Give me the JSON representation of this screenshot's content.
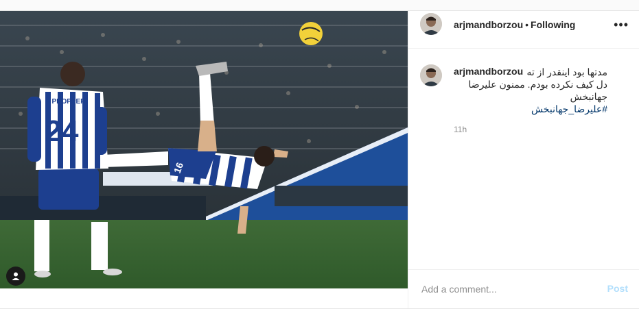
{
  "header": {
    "username": "arjmandborzou",
    "separator": "•",
    "follow_status": "Following",
    "more_icon": "more-horizontal-icon"
  },
  "caption": {
    "username": "arjmandborzou",
    "text_line1": "مدتها بود اینقدر از ته",
    "text_line2": "دل کیف نکرده بودم. ممنون علیرضا",
    "text_line3": "جهانبخش",
    "hashtag": "#علیرضا_جهانبخش",
    "time": "11h"
  },
  "photo": {
    "description_icon": "user-tag-icon",
    "shirt_name": "PROPPER",
    "shirt_number": "24",
    "kicker_number": "16"
  },
  "comment_box": {
    "placeholder": "Add a comment...",
    "post_label": "Post",
    "post_color": "#b2dffc"
  }
}
